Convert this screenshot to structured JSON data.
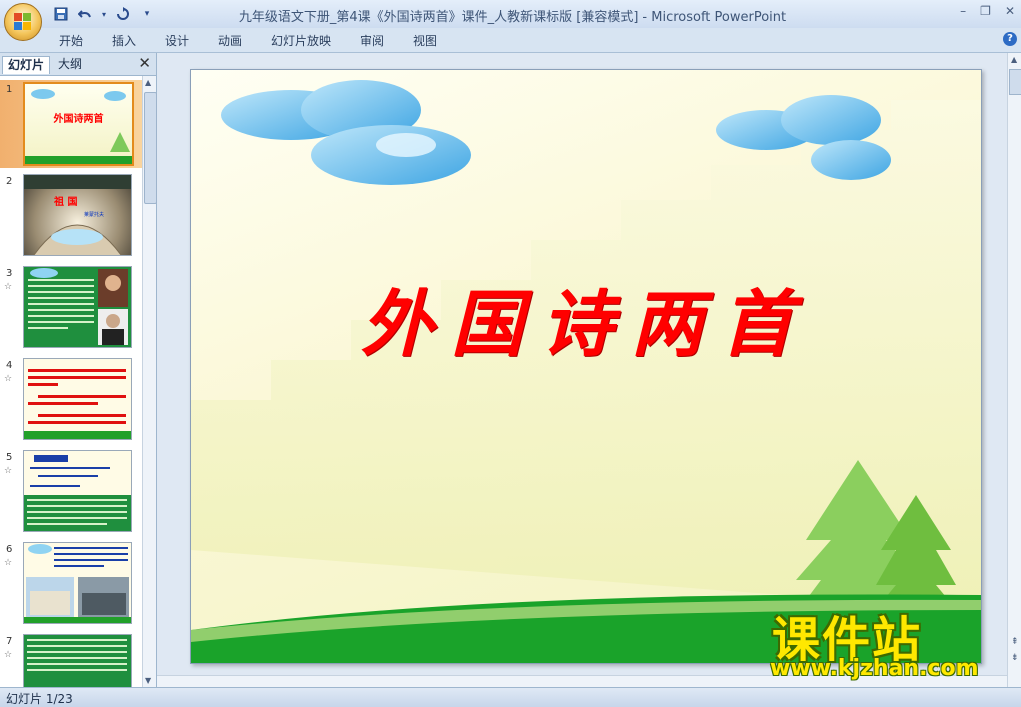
{
  "window": {
    "title": "九年级语文下册_第4课《外国诗两首》课件_人教新课标版 [兼容模式]",
    "app_name": "- Microsoft PowerPoint",
    "controls": [
      "–",
      "❐",
      "✕"
    ]
  },
  "quick_access": [
    "save-icon",
    "undo-icon",
    "redo-icon",
    "customize-icon"
  ],
  "ribbon": {
    "tabs": [
      "开始",
      "插入",
      "设计",
      "动画",
      "幻灯片放映",
      "审阅",
      "视图"
    ],
    "help": "?"
  },
  "left_pane": {
    "tabs": [
      "幻灯片",
      "大纲"
    ],
    "close": "✕",
    "thumbnails": [
      {
        "number": "1",
        "selected": true,
        "has_animation": false,
        "title": "外国诗两首"
      },
      {
        "number": "2",
        "selected": false,
        "has_animation": false,
        "title": "祖 国",
        "subtitle": "莱蒙托夫"
      },
      {
        "number": "3",
        "selected": false,
        "has_animation": true
      },
      {
        "number": "4",
        "selected": false,
        "has_animation": true
      },
      {
        "number": "5",
        "selected": false,
        "has_animation": true
      },
      {
        "number": "6",
        "selected": false,
        "has_animation": true
      },
      {
        "number": "7",
        "selected": false,
        "has_animation": true
      }
    ],
    "animation_marker": "☆"
  },
  "slide": {
    "title": "外国诗两首"
  },
  "status_bar": {
    "slide_counter": "幻灯片 1/23"
  },
  "watermark": {
    "title": "课件站",
    "url": "www.kjzhan.com"
  }
}
